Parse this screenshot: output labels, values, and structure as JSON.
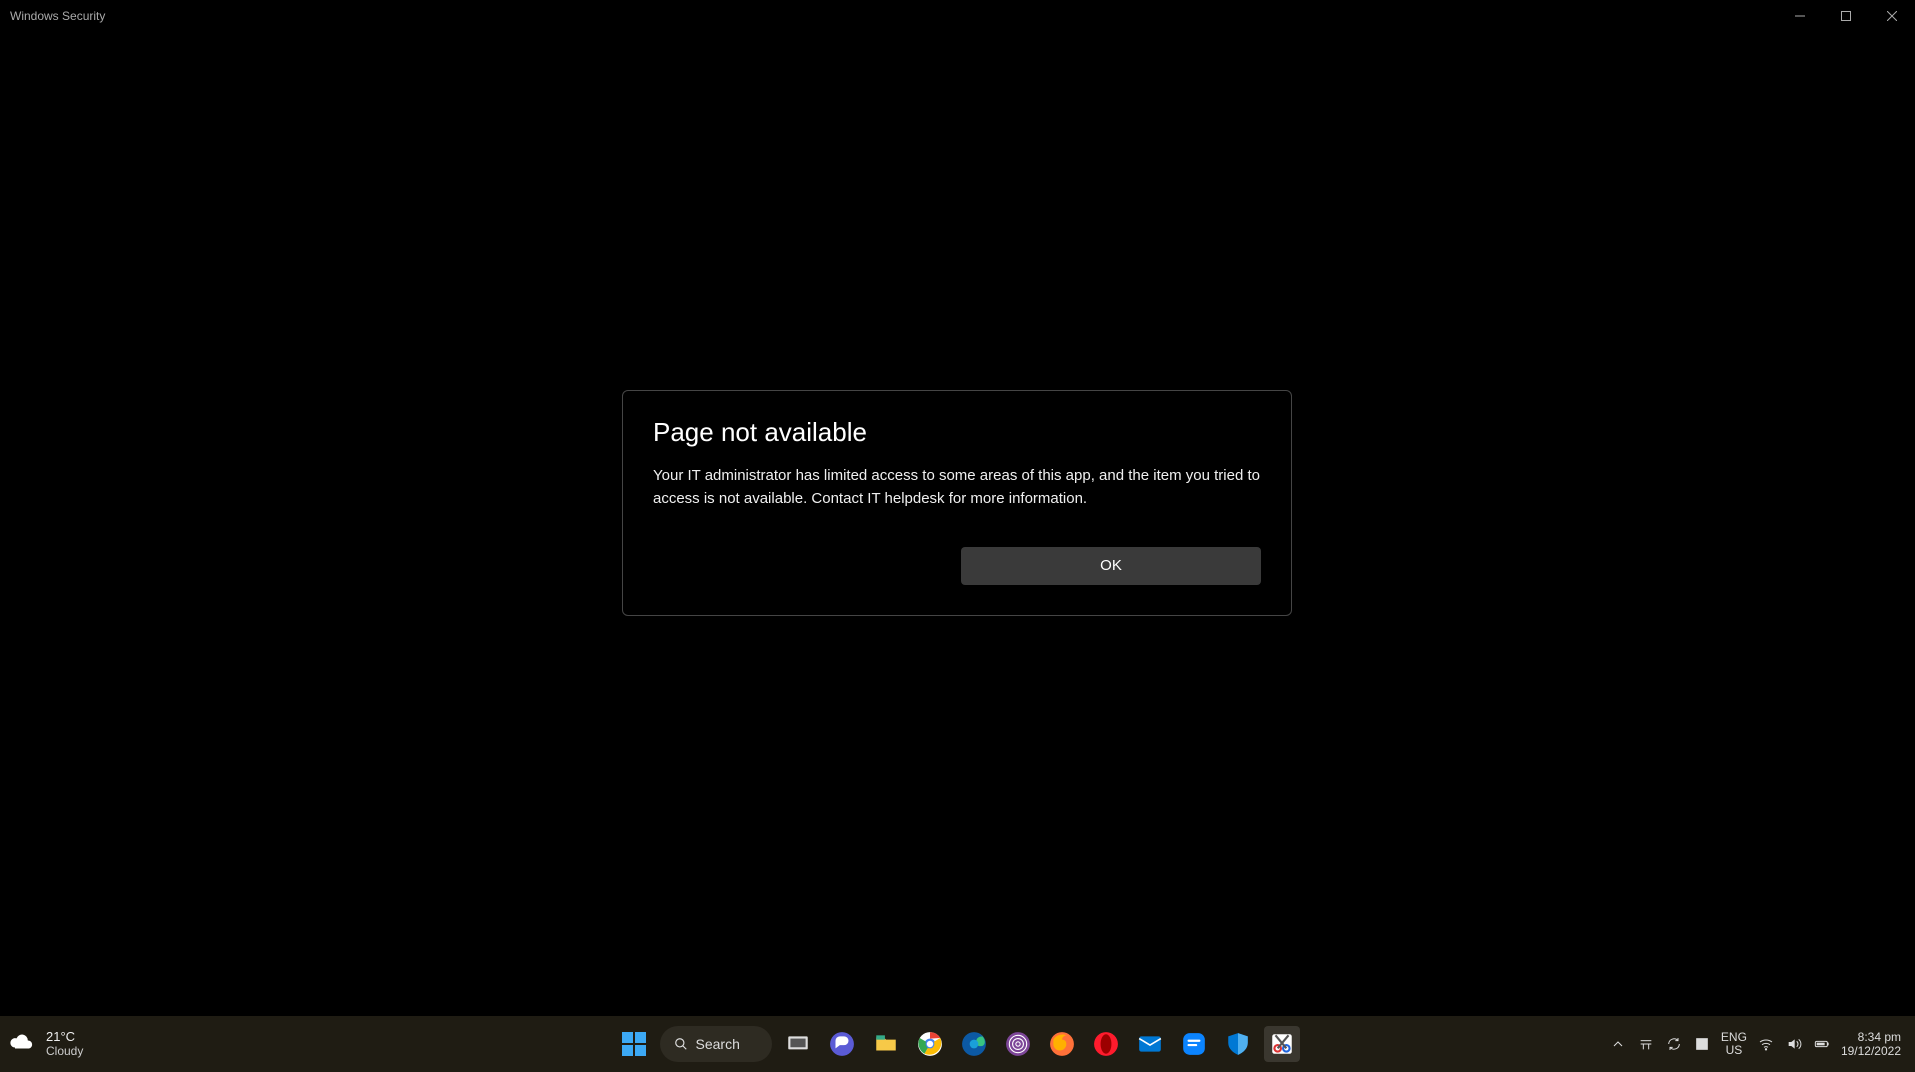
{
  "window": {
    "title": "Windows Security"
  },
  "dialog": {
    "heading": "Page not available",
    "body": "Your IT administrator has limited access to some areas of this app, and the item you tried to access is not available. Contact IT helpdesk for more information.",
    "ok_label": "OK"
  },
  "taskbar": {
    "weather_temp": "21°C",
    "weather_desc": "Cloudy",
    "search_label": "Search",
    "lang_top": "ENG",
    "lang_bottom": "US",
    "time": "8:34 pm",
    "date": "19/12/2022"
  }
}
